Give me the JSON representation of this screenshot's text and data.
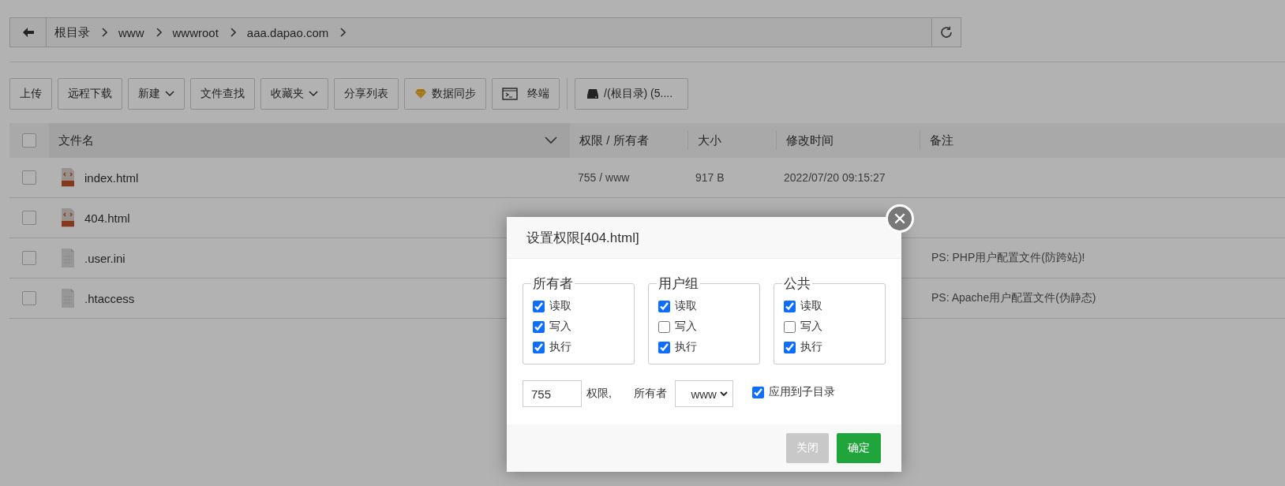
{
  "breadcrumb": {
    "items": [
      "根目录",
      "www",
      "wwwroot",
      "aaa.dapao.com"
    ]
  },
  "toolbar": [
    {
      "label": "上传",
      "kind": "plain"
    },
    {
      "label": "远程下载",
      "kind": "plain"
    },
    {
      "label": "新建",
      "kind": "dropdown"
    },
    {
      "label": "文件查找",
      "kind": "plain"
    },
    {
      "label": "收藏夹",
      "kind": "dropdown"
    },
    {
      "label": "分享列表",
      "kind": "plain"
    },
    {
      "label": "数据同步",
      "kind": "gem"
    },
    {
      "label": "终端",
      "kind": "terminal"
    },
    {
      "label": "/(根目录) (5....",
      "kind": "disk"
    }
  ],
  "table": {
    "header_checked": false,
    "columns": [
      "文件名",
      "权限 / 所有者",
      "大小",
      "修改时间",
      "备注"
    ],
    "rows": [
      {
        "checked": false,
        "kind": "html",
        "name": "index.html",
        "permissions": "755 / www",
        "size": "917 B",
        "modified": "2022/07/20 09:15:27"
      },
      {
        "checked": false,
        "kind": "html",
        "name": "404.html"
      },
      {
        "checked": false,
        "kind": "file",
        "name": ".user.ini",
        "note": "PS: PHP用户配置文件(防跨站)!"
      },
      {
        "checked": false,
        "kind": "file",
        "name": ".htaccess",
        "note": "PS: Apache用户配置文件(伪静态)"
      }
    ]
  },
  "dialog": {
    "title": "设置权限[404.html]",
    "groups": [
      {
        "title": "所有者",
        "perms": [
          {
            "label": "读取",
            "checked": true
          },
          {
            "label": "写入",
            "checked": true
          },
          {
            "label": "执行",
            "checked": true
          }
        ]
      },
      {
        "title": "用户组",
        "perms": [
          {
            "label": "读取",
            "checked": true
          },
          {
            "label": "写入",
            "checked": false
          },
          {
            "label": "执行",
            "checked": true
          }
        ]
      },
      {
        "title": "公共",
        "perms": [
          {
            "label": "读取",
            "checked": true
          },
          {
            "label": "写入",
            "checked": false
          },
          {
            "label": "执行",
            "checked": true
          }
        ]
      }
    ],
    "mode_value": "755",
    "mode_label": "权限,",
    "owner_label": "所有者",
    "owner_value": "www",
    "apply_subdirs": {
      "label": "应用到子目录",
      "checked": true
    },
    "buttons": [
      {
        "label": "关闭",
        "kind": "secondary"
      },
      {
        "label": "确定",
        "kind": "primary"
      }
    ]
  }
}
